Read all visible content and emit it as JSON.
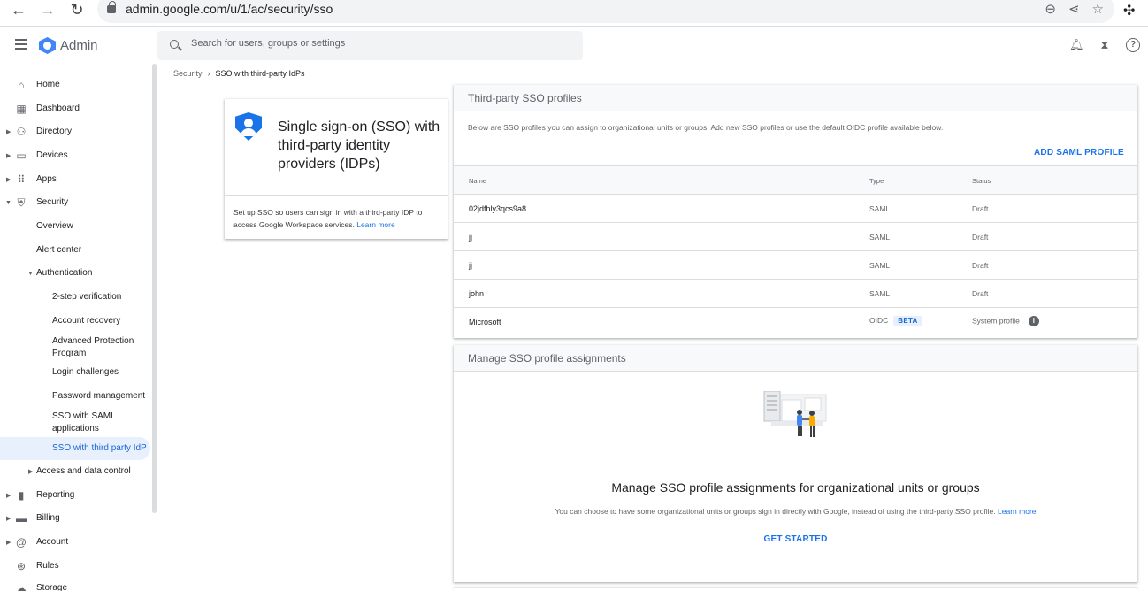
{
  "browser": {
    "url": "admin.google.com/u/1/ac/security/sso"
  },
  "header": {
    "app_title": "Admin",
    "search_placeholder": "Search for users, groups or settings"
  },
  "sidebar": {
    "items": [
      {
        "label": "Home",
        "icon": "home-icon"
      },
      {
        "label": "Dashboard",
        "icon": "dashboard-icon"
      },
      {
        "label": "Directory",
        "icon": "person-icon"
      },
      {
        "label": "Devices",
        "icon": "devices-icon"
      },
      {
        "label": "Apps",
        "icon": "apps-grid-icon"
      },
      {
        "label": "Security",
        "icon": "shield-icon"
      },
      {
        "label": "Overview"
      },
      {
        "label": "Alert center"
      },
      {
        "label": "Authentication"
      },
      {
        "label": "2-step verification"
      },
      {
        "label": "Account recovery"
      },
      {
        "label": "Advanced Protection Program"
      },
      {
        "label": "Login challenges"
      },
      {
        "label": "Password management"
      },
      {
        "label": "SSO with SAML applications"
      },
      {
        "label": "SSO with third party IdP"
      },
      {
        "label": "Access and data control"
      },
      {
        "label": "Reporting",
        "icon": "bar-chart-icon"
      },
      {
        "label": "Billing",
        "icon": "credit-card-icon"
      },
      {
        "label": "Account",
        "icon": "at-sign-icon"
      },
      {
        "label": "Rules",
        "icon": "rules-icon"
      },
      {
        "label": "Storage",
        "icon": "cloud-icon"
      }
    ]
  },
  "breadcrumb": {
    "parent": "Security",
    "separator": "›",
    "current": "SSO with third-party IdPs"
  },
  "info_card": {
    "title": "Single sign-on (SSO) with third-party identity providers (IDPs)",
    "description": "Set up SSO so users can sign in with a third-party IDP to access Google Workspace services.",
    "learn_more": "Learn more"
  },
  "profiles": {
    "title": "Third-party SSO profiles",
    "description": "Below are SSO profiles you can assign to organizational units or groups. Add new SSO profiles or use the default OIDC profile available below.",
    "add_button": "ADD SAML PROFILE",
    "columns": {
      "name": "Name",
      "type": "Type",
      "status": "Status"
    },
    "rows": [
      {
        "name": "02jdfhly3qcs9a8",
        "type": "SAML",
        "status": "Draft"
      },
      {
        "name": "jj",
        "type": "SAML",
        "status": "Draft"
      },
      {
        "name": "jj",
        "type": "SAML",
        "status": "Draft"
      },
      {
        "name": "john",
        "type": "SAML",
        "status": "Draft"
      },
      {
        "name": "Microsoft",
        "type": "OIDC",
        "badge": "BETA",
        "status": "System profile"
      }
    ]
  },
  "assignments": {
    "title": "Manage SSO profile assignments",
    "heading": "Manage SSO profile assignments for organizational units or groups",
    "description": "You can choose to have some organizational units or groups sign in directly with Google, instead of using the third-party SSO profile.",
    "learn_more": "Learn more",
    "cta": "GET STARTED"
  },
  "colors": {
    "accent": "#1a73e8",
    "active_bg": "#e8f0fe",
    "brand_logo": "#4285f4"
  }
}
